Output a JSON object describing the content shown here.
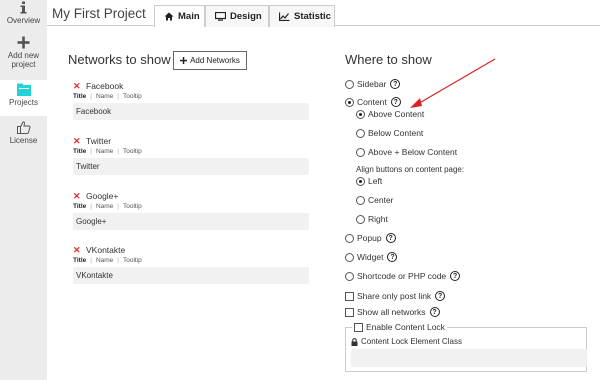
{
  "sidebar": {
    "items": [
      {
        "label": "Overview",
        "icon": "info-icon"
      },
      {
        "label_line1": "Add new",
        "label_line2": "project",
        "icon": "plus-icon"
      },
      {
        "label": "Projects",
        "icon": "folder-icon",
        "active": true
      },
      {
        "label": "License",
        "icon": "thumbs-up-icon"
      }
    ]
  },
  "header": {
    "title": "My First Project",
    "tabs": [
      {
        "label": "Main",
        "icon": "home-icon",
        "active": true
      },
      {
        "label": "Design",
        "icon": "monitor-icon"
      },
      {
        "label": "Statistic",
        "icon": "chart-icon"
      }
    ]
  },
  "networks": {
    "title": "Networks to show",
    "add_button": "Add Networks",
    "subtabs": [
      "Title",
      "Name",
      "Tooltip"
    ],
    "items": [
      {
        "name": "Facebook",
        "value": "Facebook"
      },
      {
        "name": "Twitter",
        "value": "Twitter"
      },
      {
        "name": "Google+",
        "value": "Google+"
      },
      {
        "name": "VKontakte",
        "value": "VKontakte"
      }
    ]
  },
  "where": {
    "title": "Where to show",
    "sidebar": "Sidebar",
    "content": "Content",
    "above_content": "Above Content",
    "below_content": "Below Content",
    "above_below_content": "Above + Below Content",
    "align_label": "Align buttons on content page:",
    "left": "Left",
    "center": "Center",
    "right": "Right",
    "popup": "Popup",
    "widget": "Widget",
    "shortcode": "Shortcode or PHP code",
    "share_only_post_link": "Share only post link",
    "show_all_networks": "Show all networks",
    "enable_content_lock": "Enable Content Lock",
    "content_lock_class": "Content Lock Element Class",
    "help_glyph": "?"
  },
  "colors": {
    "sidebar_bg": "#ececec",
    "active_icon": "#22d3d8",
    "remove": "#d9302c",
    "arrow": "#e02020"
  }
}
